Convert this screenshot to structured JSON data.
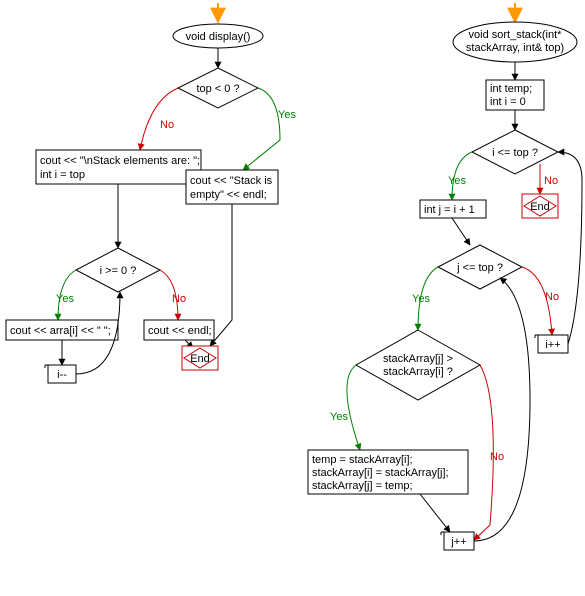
{
  "left": {
    "func": "void display()",
    "cond1": "top < 0 ?",
    "stmt_msg_line1": "cout << \"\\nStack elements are: \";",
    "stmt_msg_line2": "int i = top",
    "stmt_empty_line1": "cout << \"Stack is",
    "stmt_empty_line2": "empty\" << endl;",
    "cond2": "i >= 0 ?",
    "stmt_print": "cout << arra[i] << \" \";",
    "stmt_endl": "cout << endl;",
    "dec": "i--",
    "end": "End"
  },
  "right": {
    "func_line1": "void sort_stack(int*",
    "func_line2": "stackArray, int& top)",
    "init_line1": "int temp;",
    "init_line2": "int i = 0",
    "cond1": "i <= top ?",
    "stmt_j": "int j = i + 1",
    "cond2": "j <= top ?",
    "cond3_line1": "stackArray[j] >",
    "cond3_line2": "stackArray[i] ?",
    "swap_line1": "temp = stackArray[i];",
    "swap_line2": "stackArray[i] = stackArray[j];",
    "swap_line3": "stackArray[j] = temp;",
    "inc_j": "j++",
    "inc_i": "i++",
    "end": "End"
  },
  "labels": {
    "yes": "Yes",
    "no": "No"
  }
}
